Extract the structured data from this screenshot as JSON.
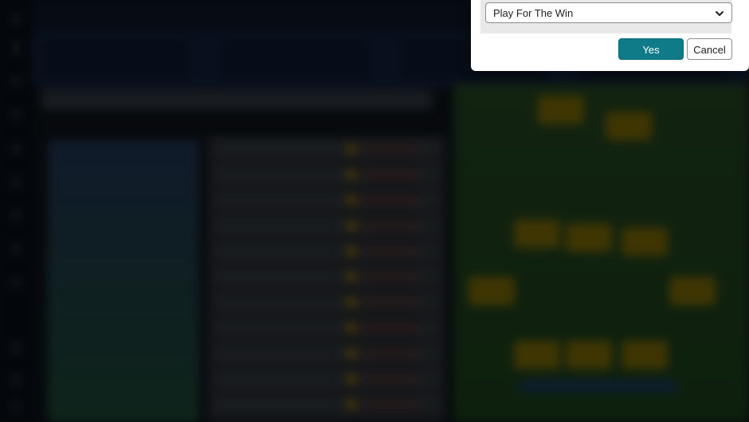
{
  "dialog": {
    "select": {
      "value": "Play For The Win"
    },
    "buttons": {
      "yes": "Yes",
      "cancel": "Cancel"
    }
  },
  "colors": {
    "accent": "#0f7b89",
    "overlay": "rgba(0,0,0,0.35)"
  },
  "icons": {
    "select_chevron": "chevron-down-icon"
  }
}
